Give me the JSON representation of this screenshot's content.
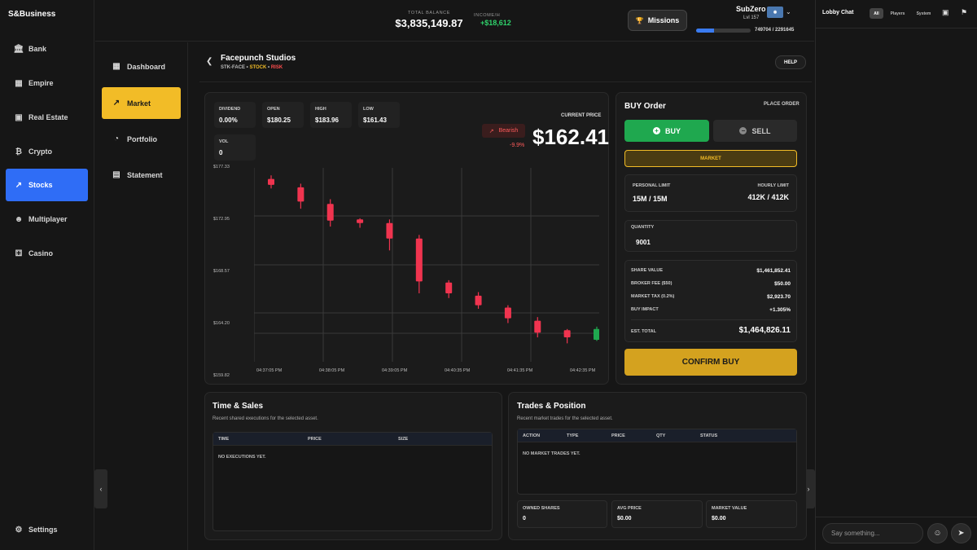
{
  "app": {
    "brand": "S&Business"
  },
  "nav": {
    "items": [
      {
        "label": "Bank",
        "icon": "bank-icon"
      },
      {
        "label": "Empire",
        "icon": "building-icon"
      },
      {
        "label": "Real Estate",
        "icon": "city-icon"
      },
      {
        "label": "Crypto",
        "icon": "bitcoin-icon"
      },
      {
        "label": "Stocks",
        "icon": "trend-icon"
      },
      {
        "label": "Multiplayer",
        "icon": "users-icon"
      },
      {
        "label": "Casino",
        "icon": "dice-icon"
      }
    ],
    "settings": "Settings"
  },
  "subnav": {
    "items": [
      {
        "label": "Dashboard"
      },
      {
        "label": "Market"
      },
      {
        "label": "Portfolio"
      },
      {
        "label": "Statement"
      }
    ]
  },
  "topbar": {
    "total_balance_label": "TOTAL BALANCE",
    "total_balance": "$3,835,149.87",
    "income_label": "INCOME/H",
    "income": "+$18,612",
    "missions": "Missions",
    "username": "SubZero",
    "level": "Lvl 157",
    "xp_text": "749704 / 2291645",
    "xp_fraction": 0.327
  },
  "asset": {
    "name": "Facepunch Studios",
    "ticker": "STK-FACE",
    "sep": "•",
    "type": "STOCK",
    "risk": "RISK",
    "help": "HELP"
  },
  "stats": {
    "dividend_label": "DIVIDEND",
    "dividend": "0.00%",
    "open_label": "OPEN",
    "open": "$180.25",
    "high_label": "HIGH",
    "high": "$183.96",
    "low_label": "LOW",
    "low": "$161.43",
    "vol_label": "VOL",
    "vol": "0"
  },
  "price": {
    "trend": "Bearish",
    "change": "-9.9%",
    "label": "CURRENT PRICE",
    "value": "$162.41"
  },
  "chart_data": {
    "type": "candlestick",
    "y_ticks": [
      "$177.33",
      "$172.95",
      "$168.57",
      "$164.20",
      "$159.82"
    ],
    "x_ticks": [
      "04:37:05 PM",
      "04:38:05 PM",
      "04:39:05 PM",
      "04:40:35 PM",
      "04:41:35 PM",
      "04:42:35 PM"
    ],
    "ylim": [
      159.82,
      177.33
    ],
    "grid": true,
    "candles": [
      {
        "open": 176.4,
        "close": 175.9,
        "high": 176.7,
        "low": 175.6
      },
      {
        "open": 175.7,
        "close": 174.5,
        "high": 176.0,
        "low": 173.9
      },
      {
        "open": 174.3,
        "close": 172.9,
        "high": 174.7,
        "low": 172.4
      },
      {
        "open": 173.0,
        "close": 172.7,
        "high": 173.1,
        "low": 172.3
      },
      {
        "open": 172.7,
        "close": 171.4,
        "high": 173.0,
        "low": 170.4
      },
      {
        "open": 171.4,
        "close": 167.8,
        "high": 171.7,
        "low": 166.8
      },
      {
        "open": 167.7,
        "close": 166.8,
        "high": 167.9,
        "low": 166.4
      },
      {
        "open": 166.6,
        "close": 165.8,
        "high": 166.9,
        "low": 165.5
      },
      {
        "open": 165.6,
        "close": 164.7,
        "high": 165.8,
        "low": 164.3
      },
      {
        "open": 164.5,
        "close": 163.5,
        "high": 164.8,
        "low": 163.1
      },
      {
        "open": 163.7,
        "close": 163.1,
        "high": 163.8,
        "low": 162.6
      },
      {
        "open": 162.9,
        "close": 163.8,
        "high": 164.0,
        "low": 162.8
      }
    ]
  },
  "order": {
    "title": "BUY Order",
    "place_order": "PLACE ORDER",
    "buy": "BUY",
    "sell": "SELL",
    "market": "MARKET",
    "personal_limit_label": "PERSONAL LIMIT",
    "personal_limit": "15M / 15M",
    "hourly_limit_label": "HOURLY LIMIT",
    "hourly_limit": "412K / 412K",
    "quantity_label": "QUANTITY",
    "quantity": "9001",
    "share_value_label": "SHARE VALUE",
    "share_value": "$1,461,852.41",
    "broker_fee_label": "BROKER FEE ($50)",
    "broker_fee": "$50.00",
    "market_tax_label": "MARKET TAX (0.2%)",
    "market_tax": "$2,923.70",
    "buy_impact_label": "BUY IMPACT",
    "buy_impact": "+1.305%",
    "est_total_label": "EST. TOTAL",
    "est_total": "$1,464,826.11",
    "confirm": "CONFIRM BUY"
  },
  "time_sales": {
    "title": "Time & Sales",
    "subtitle": "Recent shared executions for the selected asset.",
    "columns": [
      "TIME",
      "PRICE",
      "SIZE"
    ],
    "empty": "NO EXECUTIONS YET."
  },
  "trades": {
    "title": "Trades & Position",
    "subtitle": "Recent market trades for the selected asset.",
    "columns": [
      "ACTION",
      "TYPE",
      "PRICE",
      "QTY",
      "STATUS"
    ],
    "empty": "NO MARKET TRADES YET.",
    "owned_label": "OWNED SHARES",
    "owned": "0",
    "avg_label": "AVG PRICE",
    "avg": "$0.00",
    "mv_label": "MARKET VALUE",
    "mv": "$0.00"
  },
  "chat": {
    "title": "Lobby Chat",
    "tabs": [
      "All",
      "Players",
      "System"
    ],
    "placeholder": "Say something..."
  },
  "colors": {
    "accent_blue": "#2f6df6",
    "accent_gold": "#f2bc27",
    "bull": "#1fa84f",
    "bear": "#f0344f"
  }
}
